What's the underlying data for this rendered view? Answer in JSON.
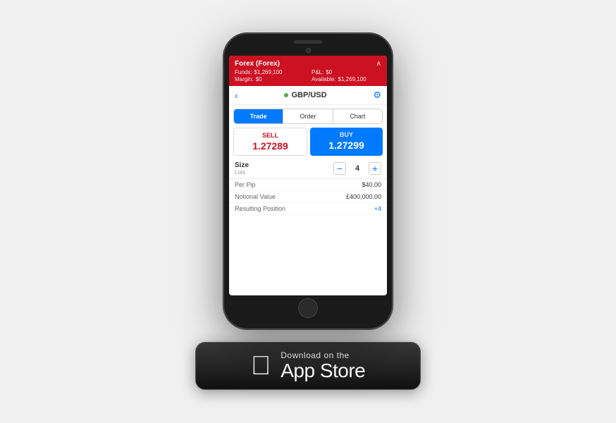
{
  "page": {
    "background": "#f0f0f0"
  },
  "phone": {
    "header": {
      "title": "Forex (Forex)",
      "chevron": "^",
      "funds_label": "Funds:",
      "funds_value": "$1,269,100",
      "pl_label": "P&L:",
      "pl_value": "$0",
      "margin_label": "Margin:",
      "margin_value": "$0",
      "available_label": "Available:",
      "available_value": "$1,269,100"
    },
    "symbol_bar": {
      "back": "<",
      "dot_color": "#4caf50",
      "symbol": "GBP/USD"
    },
    "tabs": [
      {
        "label": "Trade",
        "active": true
      },
      {
        "label": "Order",
        "active": false
      },
      {
        "label": "Chart",
        "active": false
      }
    ],
    "sell": {
      "label": "SELL",
      "price": "1.27289"
    },
    "buy": {
      "label": "BUY",
      "price": "1.27299"
    },
    "size": {
      "label": "Size",
      "sublabel": "Lots",
      "value": "4",
      "minus": "−",
      "plus": "+"
    },
    "info_rows": [
      {
        "label": "Per Pip",
        "value": "$40.00",
        "blue": false
      },
      {
        "label": "Notional Value",
        "value": "£400,000.00",
        "blue": false
      },
      {
        "label": "Resulting Position",
        "value": "+4",
        "blue": true
      }
    ]
  },
  "appstore": {
    "top_text": "Download on the",
    "bottom_text": "App Store",
    "apple_symbol": ""
  }
}
